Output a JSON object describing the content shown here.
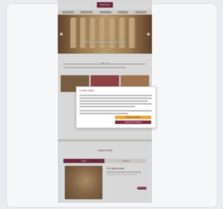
{
  "brand": {
    "logo_text": "INVIVO",
    "accent": "#7b2b3f"
  },
  "nav": {
    "items": [
      "",
      "",
      "",
      "",
      ""
    ]
  },
  "hero": {
    "title": "Grain solutions for growth"
  },
  "cookie_modal": {
    "title": "Cookie policy",
    "accept_label": "Accept all cookies",
    "settings_label": "Cookie settings",
    "reject_label": "Reject all"
  },
  "news": {
    "title": "Latest news",
    "tab_active": "News",
    "tab_other": "Events",
    "card_title": "Our latest article",
    "read_more": "Read more"
  }
}
